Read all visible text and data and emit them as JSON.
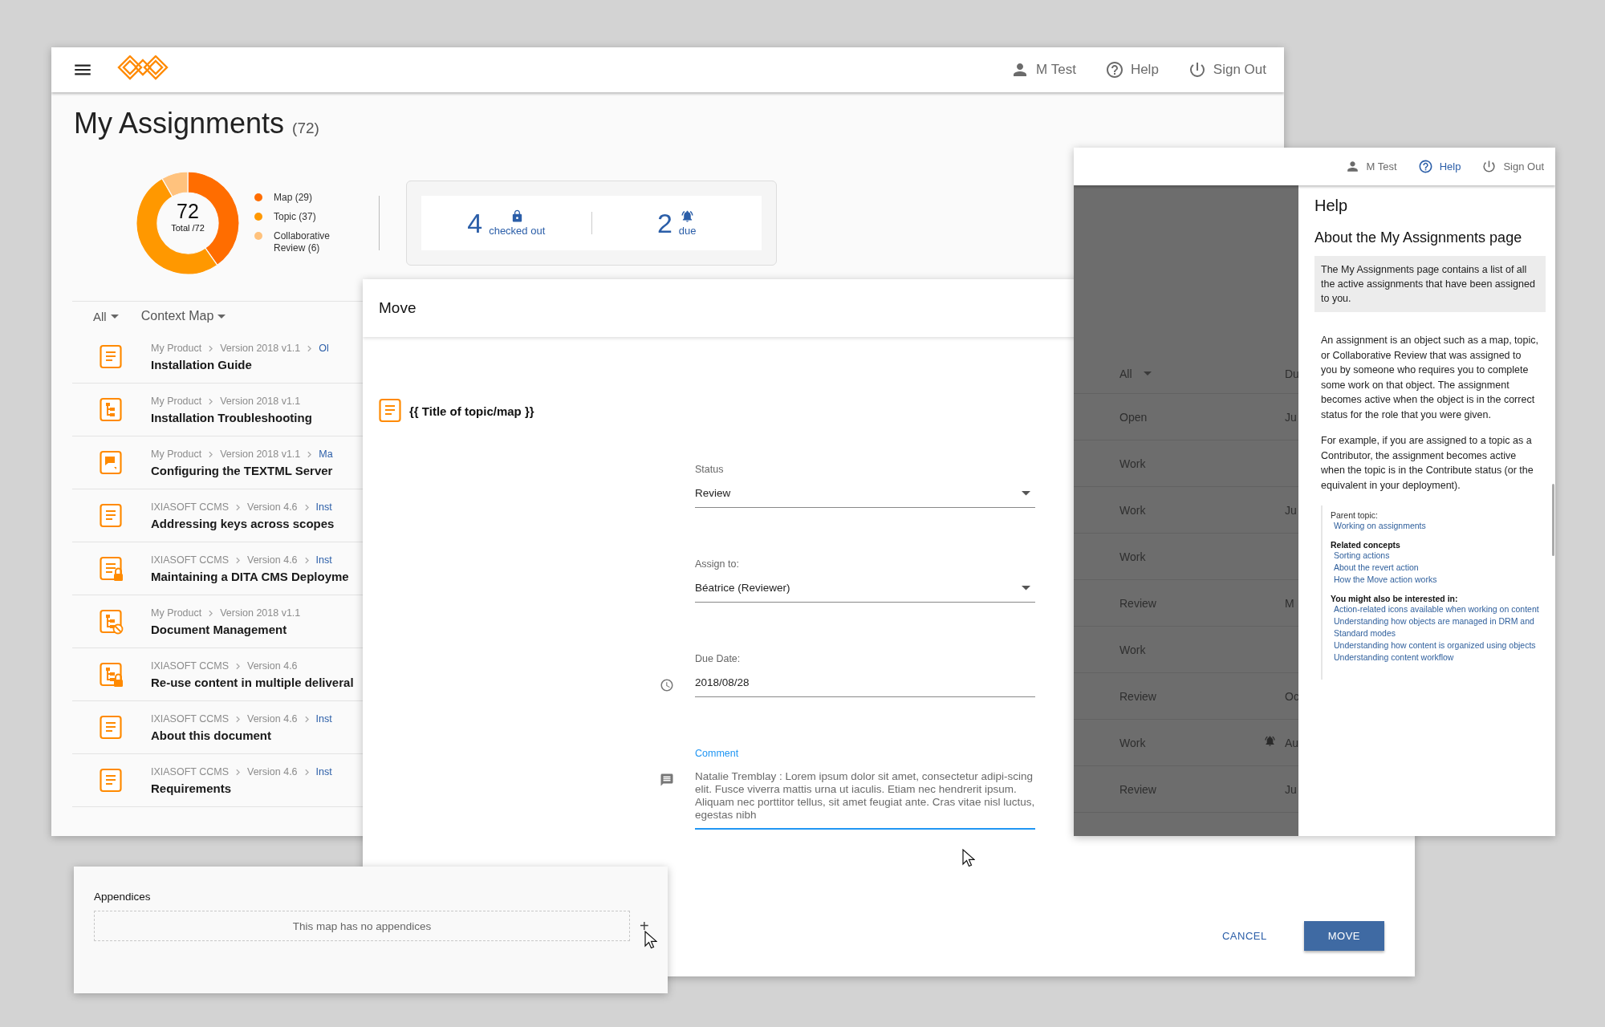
{
  "main_window": {
    "header": {
      "nav": [
        {
          "kind": "user",
          "label": "M Test",
          "selected": false
        },
        {
          "kind": "help",
          "label": "Help",
          "selected": false
        },
        {
          "kind": "signout",
          "label": "Sign Out",
          "selected": false
        }
      ]
    },
    "title": "My Assignments",
    "count": "(72)",
    "summary": {
      "total": "72",
      "total_label": "Total /72",
      "chart_data": {
        "type": "donut",
        "categories": [
          "Map (29)",
          "Topic (37)",
          "Collaborative Review (6)"
        ],
        "values": [
          29,
          37,
          6
        ]
      },
      "legend": [
        {
          "color": "#ff6d00"
        },
        {
          "color": "#ff9800"
        },
        {
          "color": "#ffc27d"
        }
      ]
    },
    "stats": [
      {
        "kind": "lock",
        "value": "4",
        "label": "checked out"
      },
      {
        "kind": "bell",
        "value": "2",
        "label": "due"
      }
    ],
    "filters": [
      "All",
      "Context Map"
    ],
    "assignments": [
      {
        "kind": "topic",
        "path": [
          "My Product",
          "Version 2018 v1.1"
        ],
        "link": "Ol",
        "title": "Installation Guide"
      },
      {
        "kind": "map",
        "path": [
          "My Product",
          "Version 2018 v1.1"
        ],
        "title": "Installation Troubleshooting"
      },
      {
        "kind": "review",
        "path": [
          "My Product",
          "Version 2018 v1.1"
        ],
        "link": "Ma",
        "title": "Configuring the TEXTML Server"
      },
      {
        "kind": "topic",
        "path": [
          "IXIASOFT CCMS",
          "Version 4.6"
        ],
        "link": "Inst",
        "title": "Addressing keys across scopes"
      },
      {
        "kind": "topic-locked",
        "path": [
          "IXIASOFT CCMS",
          "Version 4.6"
        ],
        "link": "Inst",
        "title": "Maintaining a DITA CMS Deployme"
      },
      {
        "kind": "map-blocked",
        "path": [
          "My Product",
          "Version 2018 v1.1"
        ],
        "title": "Document Management"
      },
      {
        "kind": "map-locked",
        "path": [
          "IXIASOFT CCMS",
          "Version 4.6"
        ],
        "title": "Re-use content in multiple deliveral"
      },
      {
        "kind": "topic",
        "path": [
          "IXIASOFT CCMS",
          "Version 4.6"
        ],
        "link": "Inst",
        "title": "About this document"
      },
      {
        "kind": "topic",
        "path": [
          "IXIASOFT CCMS",
          "Version 4.6"
        ],
        "link": "Inst",
        "title": "Requirements"
      }
    ]
  },
  "move_dialog": {
    "title": "Move",
    "item_title": "{{ Title of topic/map }}",
    "fields": [
      {
        "kind": "select",
        "label": "Status",
        "value": "Review",
        "focused": false
      },
      {
        "kind": "select",
        "label": "Assign to:",
        "value": "Béatrice (Reviewer)",
        "focused": false
      },
      {
        "kind": "date",
        "label": "Due Date:",
        "value": "2018/08/28",
        "focused": false
      },
      {
        "kind": "comment",
        "label": "Comment",
        "value": "Natalie Tremblay  : Lorem ipsum dolor sit amet, consectetur adipi-scing elit. Fusce viverra mattis urna ut iaculis. Etiam nec hendrerit ipsum. Aliquam nec porttitor tellus, sit amet feugiat ante. Cras vitae nisl luctus, egestas nibh",
        "focused": true
      }
    ],
    "buttons": [
      {
        "kind": "text",
        "label": "CANCEL"
      },
      {
        "kind": "primary",
        "label": "MOVE"
      }
    ]
  },
  "help_window": {
    "header": {
      "nav": [
        {
          "kind": "user",
          "label": "M Test",
          "selected": false
        },
        {
          "kind": "help",
          "label": "Help",
          "selected": true
        },
        {
          "kind": "signout",
          "label": "Sign Out",
          "selected": false
        }
      ]
    },
    "background_list": {
      "filter": "All",
      "column_2": "Du",
      "rows": [
        {
          "status": "Open",
          "column_2": "Ju",
          "alert": false
        },
        {
          "status": "Work",
          "alert": false
        },
        {
          "status": "Work",
          "column_2": "Ju",
          "alert": false
        },
        {
          "status": "Work",
          "alert": false
        },
        {
          "status": "Review",
          "column_2": "M",
          "alert": false
        },
        {
          "status": "Work",
          "alert": false
        },
        {
          "status": "Review",
          "column_2": "Oc",
          "alert": false
        },
        {
          "status": "Work",
          "column_2": "Au",
          "alert": true
        },
        {
          "status": "Review",
          "column_2": "Ju",
          "alert": false
        }
      ]
    },
    "help": {
      "title": "Help",
      "heading": "About the My Assignments page",
      "summary": "The My Assignments page contains a list of all the active assignments that have been assigned to you.",
      "paragraphs": [
        "An assignment is an object such as a map, topic, or Collaborative Review that was assigned to you by someone who requires you to complete some work on that object. The assignment becomes active when the object is in the correct status for the role that you were given.",
        "For example, if you are assigned to a topic as a Contributor, the assignment becomes active when the topic is in the Contribute status (or the equivalent in your deployment)."
      ],
      "parent_label": "Parent topic:",
      "parent_link": "Working on assignments",
      "sections": [
        {
          "heading": "Related concepts",
          "links": [
            "Sorting actions",
            "About the revert action",
            "How the Move action works"
          ]
        },
        {
          "heading": "You might also be interested in:",
          "links": [
            "Action-related icons available when working on content",
            "Understanding how objects are managed in DRM and Standard modes",
            "Understanding how content is organized using objects",
            "Understanding content workflow"
          ]
        }
      ]
    }
  },
  "appendices_panel": {
    "title": "Appendices",
    "empty_text": "This map has no appendices",
    "add_label": "+"
  }
}
